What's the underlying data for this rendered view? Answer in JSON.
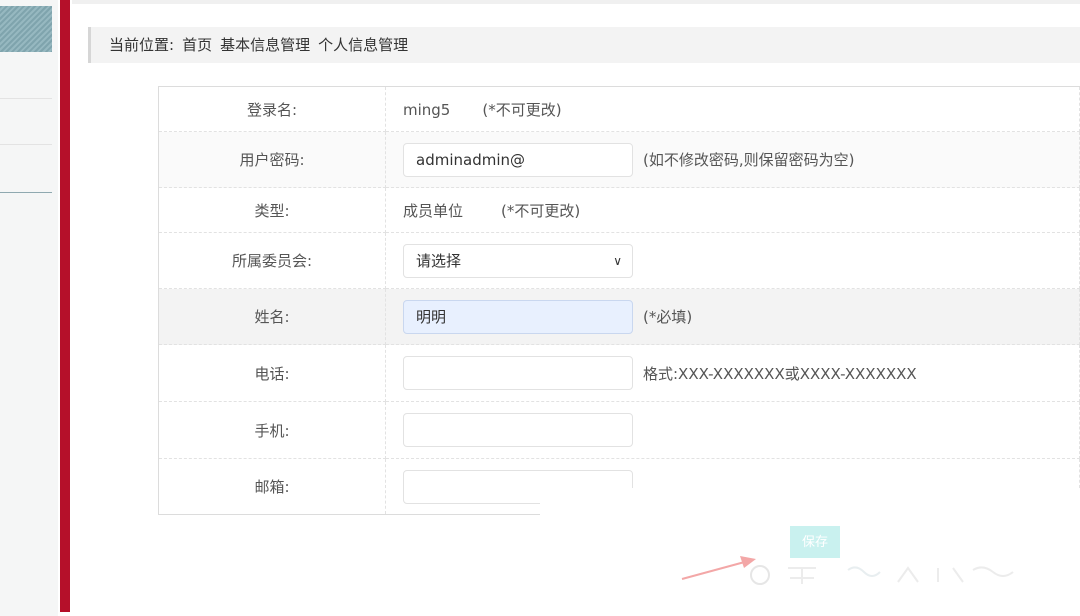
{
  "breadcrumb": {
    "label": "当前位置:",
    "items": [
      "首页",
      "基本信息管理",
      "个人信息管理"
    ]
  },
  "form": {
    "rows": [
      {
        "label": "登录名:",
        "value": "ming5",
        "note": "(*不可更改)"
      },
      {
        "label": "用户密码:",
        "value": "adminadmin@",
        "note": "(如不修改密码,则保留密码为空)"
      },
      {
        "label": "类型:",
        "value": "成员单位",
        "note": "(*不可更改)"
      },
      {
        "label": "所属委员会:",
        "value": "请选择"
      },
      {
        "label": "姓名:",
        "value": "明明",
        "note": "(*必填)"
      },
      {
        "label": "电话:",
        "value": "",
        "note": "格式:XXX-XXXXXXX或XXXX-XXXXXXX"
      },
      {
        "label": "手机:",
        "value": ""
      },
      {
        "label": "邮箱:",
        "value": ""
      }
    ]
  },
  "actions": {
    "save_label": "保存"
  },
  "colors": {
    "accent_bar": "#b5102a",
    "save_button": "#c9f1ef",
    "autofill": "#e8f0fe"
  }
}
